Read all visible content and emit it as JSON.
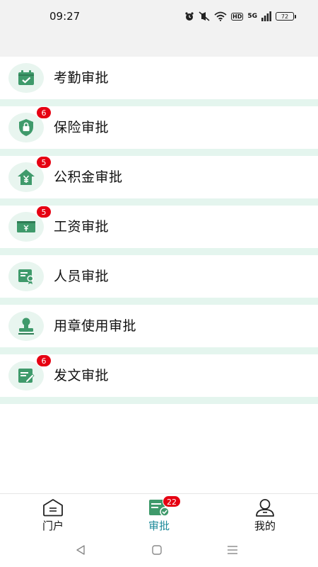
{
  "status_bar": {
    "time": "09:27",
    "network_label": "5G",
    "hd_label": "HD",
    "battery": "72"
  },
  "approvals": [
    {
      "label": "考勤审批",
      "icon": "calendar-check-icon",
      "badge": ""
    },
    {
      "label": "保险审批",
      "icon": "shield-lock-icon",
      "badge": "6"
    },
    {
      "label": "公积金审批",
      "icon": "house-yen-icon",
      "badge": "5"
    },
    {
      "label": "工资审批",
      "icon": "banknote-yen-icon",
      "badge": "5"
    },
    {
      "label": "人员审批",
      "icon": "certificate-icon",
      "badge": ""
    },
    {
      "label": "用章使用审批",
      "icon": "stamp-icon",
      "badge": ""
    },
    {
      "label": "发文审批",
      "icon": "document-edit-icon",
      "badge": "6"
    }
  ],
  "tabbar": {
    "portal": "门户",
    "approval": "审批",
    "approval_badge": "22",
    "mine": "我的"
  },
  "colors": {
    "accent": "#1e8a9a",
    "icon_green": "#3f9a6b",
    "badge_red": "#e60012",
    "divider": "#e4f5ee"
  }
}
